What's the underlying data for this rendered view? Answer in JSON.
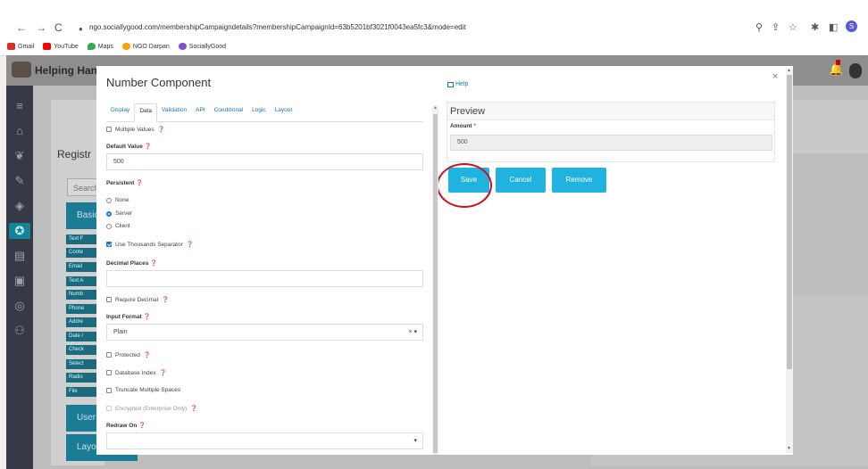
{
  "browser": {
    "back_icon": "←",
    "forward_icon": "→",
    "reload_icon": "C",
    "url": "ngo.sociallygood.com/membershipCampaigndetails?membershipCampaignId=63b5201bf3021f0043ea5fc3&mode=edit",
    "profile_initial": "S",
    "bookmarks": [
      {
        "label": "Gmail",
        "color": "#d93025"
      },
      {
        "label": "YouTube",
        "color": "#ff0000"
      },
      {
        "label": "Maps",
        "color": "#34a853"
      },
      {
        "label": "NGO Darpan",
        "color": "#f4a300"
      },
      {
        "label": "SociallyGood",
        "color": "#7b4fd6"
      }
    ]
  },
  "app": {
    "title": "Helping Han",
    "registration_label": "Registr",
    "search_placeholder": "Search",
    "basic_label": "Basic",
    "user_label": "User",
    "layout_label": "Layo",
    "components": [
      "Text F",
      "Conte",
      "Email",
      "Text A",
      "Numb",
      "Phone",
      "Addre",
      "Date /",
      "Check",
      "Select",
      "Radio",
      "File"
    ]
  },
  "modal": {
    "title": "Number Component",
    "help_label": "Help",
    "close_label": "×",
    "tabs": [
      "Display",
      "Data",
      "Validation",
      "API",
      "Conditional",
      "Logic",
      "Layout"
    ],
    "active_tab": "Data",
    "multiple_values_label": "Multiple Values",
    "default_value_label": "Default Value",
    "default_value": "500",
    "persistent_label": "Persistent",
    "persistent_options": [
      "None",
      "Server",
      "Client"
    ],
    "persistent_selected": "Server",
    "thousands_separator_label": "Use Thousands Separator",
    "decimal_places_label": "Decimal Places",
    "decimal_places_value": "",
    "require_decimal_label": "Require Decimal",
    "input_format_label": "Input Format",
    "input_format_value": "Plain",
    "protected_label": "Protected",
    "database_index_label": "Database Index",
    "truncate_label": "Truncate Multiple Spaces",
    "encrypted_label": "Encrypted (Enterprise Only)",
    "redraw_label": "Redraw On",
    "redraw_value": ""
  },
  "preview": {
    "heading": "Preview",
    "amount_label": "Amount",
    "required_mark": "*",
    "amount_value": "500"
  },
  "actions": {
    "save": "Save",
    "cancel": "Cancel",
    "remove": "Remove"
  }
}
